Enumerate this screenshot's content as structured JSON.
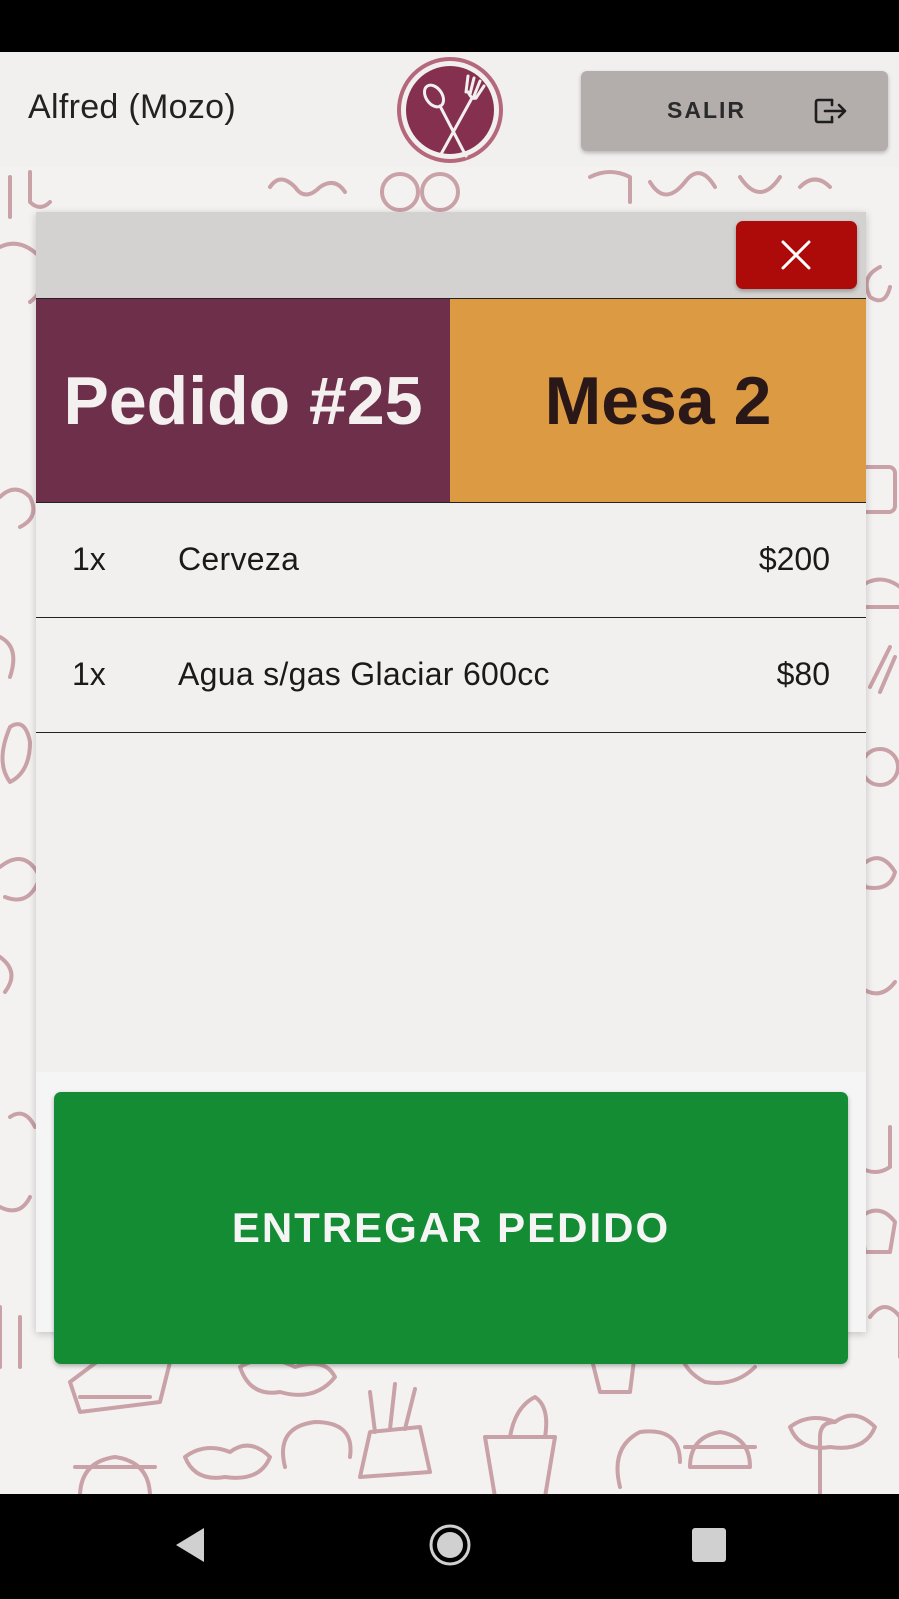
{
  "header": {
    "user_name": "Alfred (Mozo)",
    "logout_label": "SALIR",
    "logo_icon": "spoon-fork-logo-icon",
    "logout_icon": "exit-icon"
  },
  "modal": {
    "close_icon": "close-icon",
    "order_title": "Pedido #25",
    "table_title": "Mesa 2",
    "items": [
      {
        "qty": "1x",
        "name": "Cerveza",
        "price": "$200"
      },
      {
        "qty": "1x",
        "name": "Agua s/gas Glaciar 600cc",
        "price": "$80"
      }
    ],
    "deliver_label": "ENTREGAR PEDIDO"
  },
  "colors": {
    "brand": "#6d2f4a",
    "accent": "#dc9a43",
    "close": "#ad0a0a",
    "deliver": "#138c33"
  }
}
